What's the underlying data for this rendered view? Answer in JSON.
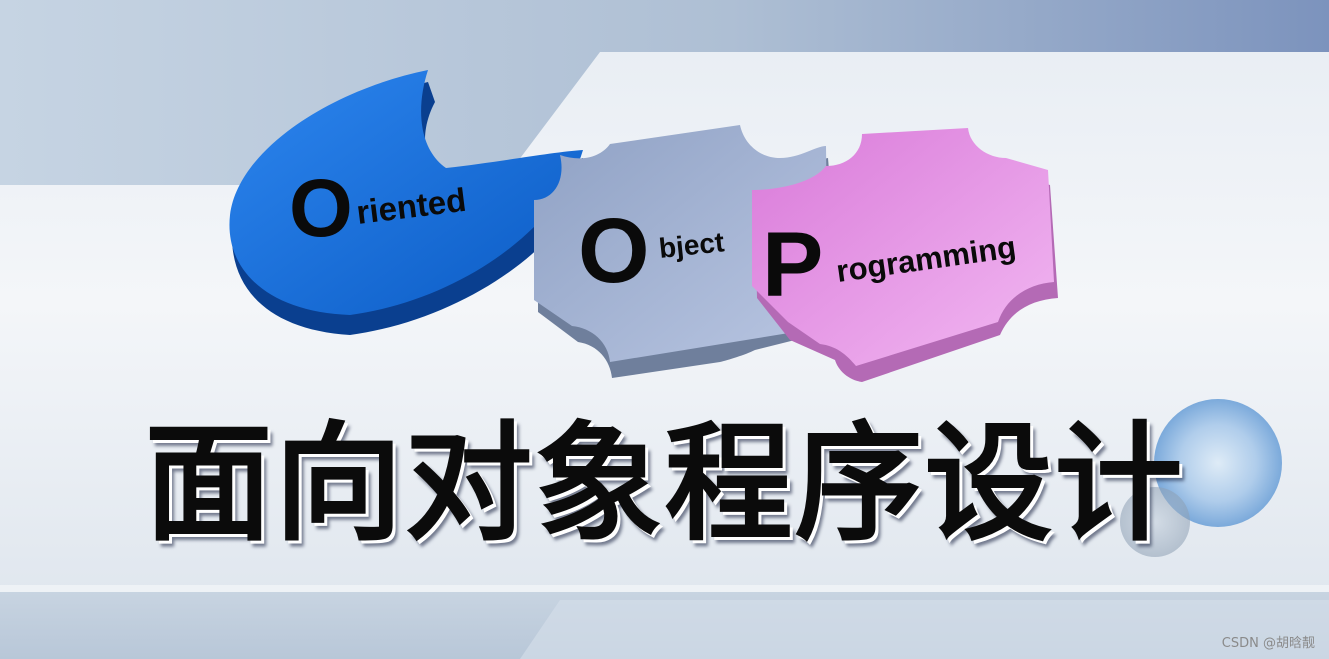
{
  "logo": {
    "oriented": {
      "letter": "O",
      "word": "riented"
    },
    "object": {
      "letter": "O",
      "word": "bject"
    },
    "programming": {
      "letter": "P",
      "word": "rogramming"
    }
  },
  "headline": "面向对象程序设计",
  "watermark": "CSDN @胡晗靓",
  "colors": {
    "oriented_piece": "#1b6fd8",
    "object_piece": "#a8b8d8",
    "programming_piece": "#e89ae8",
    "accent_circle": "#7fb0e0"
  }
}
